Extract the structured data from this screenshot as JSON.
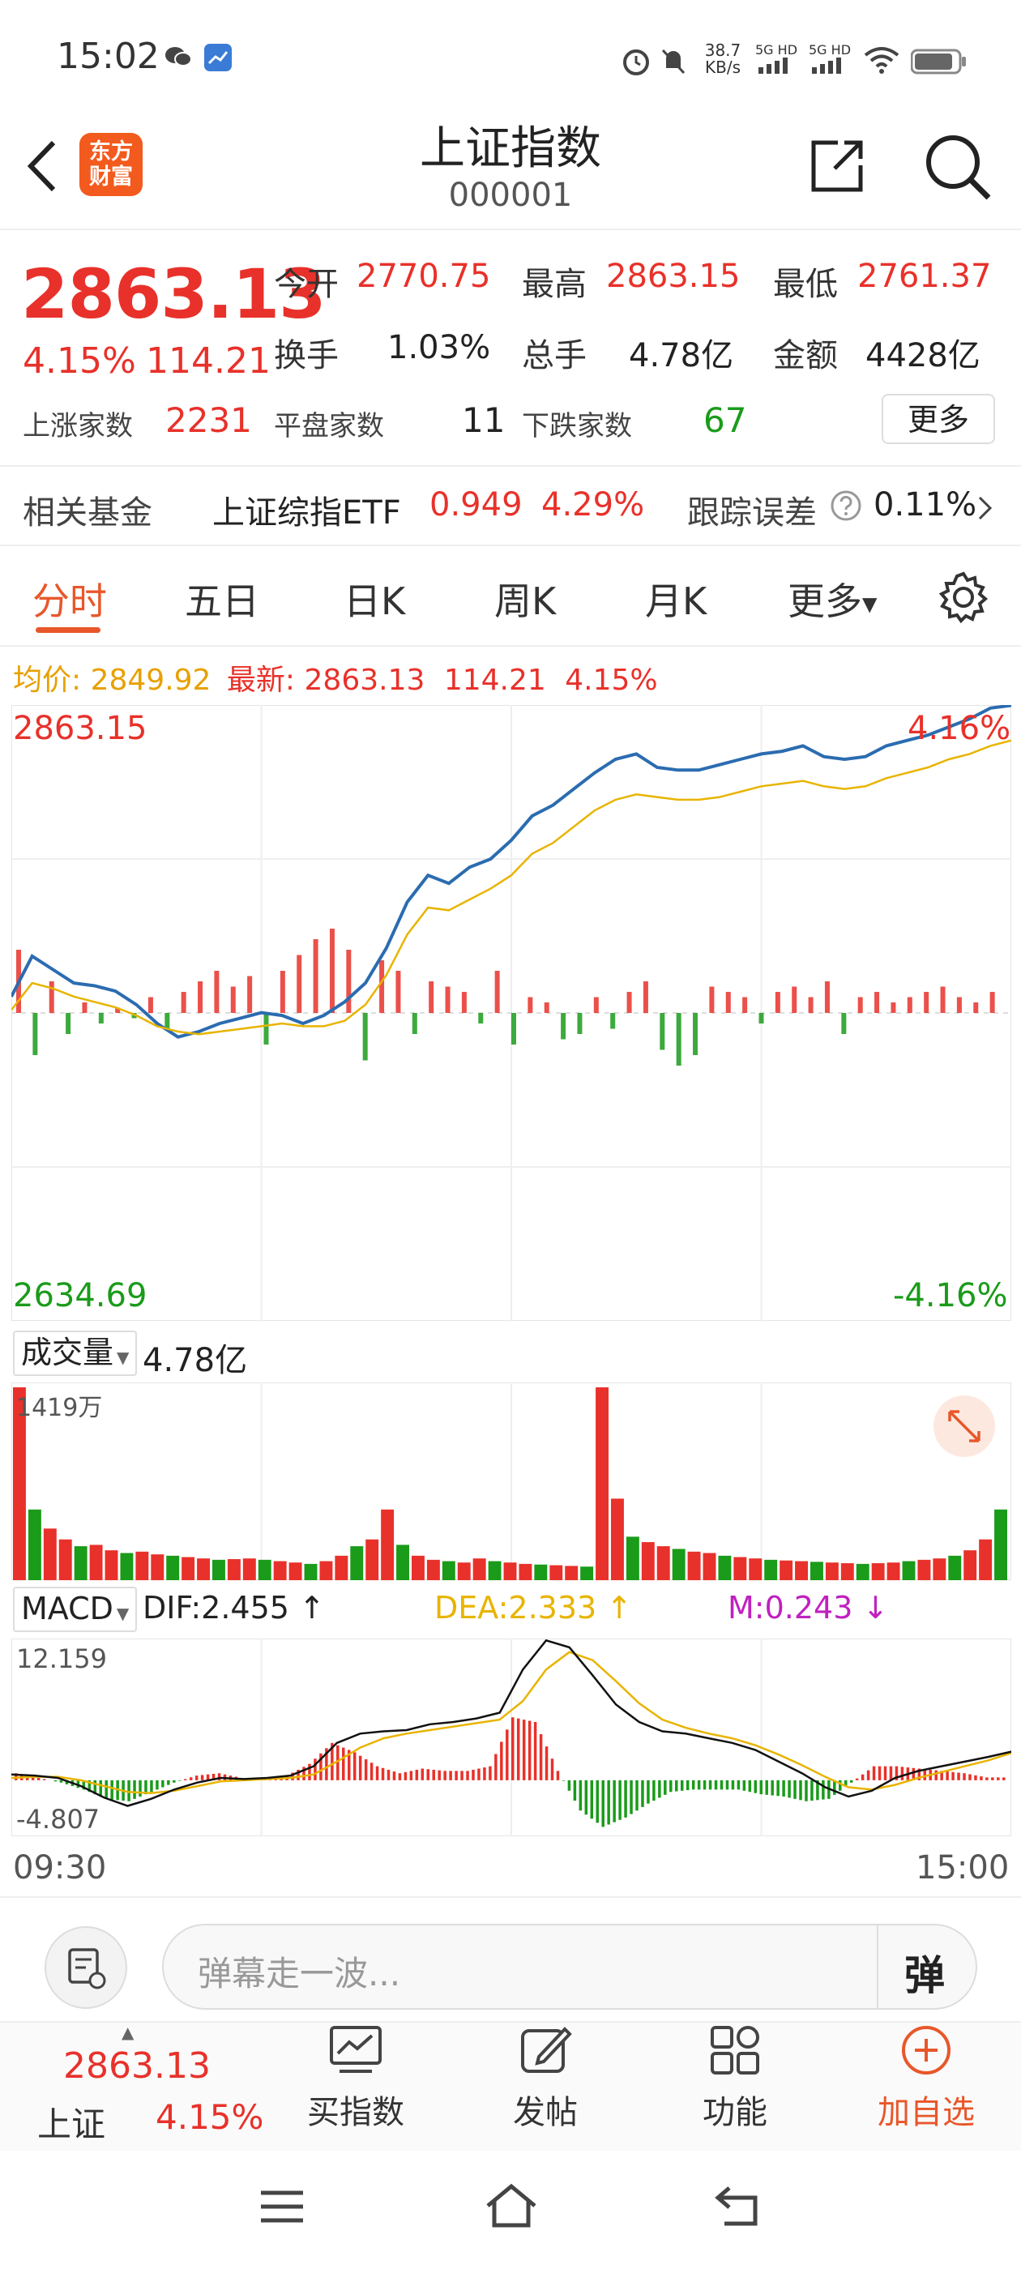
{
  "status_bar": {
    "time": "15:02",
    "net_speed_value": "38.7",
    "net_speed_unit": "KB/s",
    "sim1": "5G HD",
    "sim2": "5G HD"
  },
  "header": {
    "title": "上证指数",
    "code": "000001",
    "logo_line1": "东方",
    "logo_line2": "财富"
  },
  "quote": {
    "price": "2863.13",
    "change_pct": "4.15%",
    "change": "114.21",
    "open_label": "今开",
    "open": "2770.75",
    "high_label": "最高",
    "high": "2863.15",
    "low_label": "最低",
    "low": "2761.37",
    "turnover_label": "换手",
    "turnover": "1.03%",
    "volume_label": "总手",
    "volume": "4.78亿",
    "amount_label": "金额",
    "amount": "4428亿",
    "up_label": "上涨家数",
    "up": "2231",
    "flat_label": "平盘家数",
    "flat": "11",
    "down_label": "下跌家数",
    "down": "67",
    "more": "更多"
  },
  "fund": {
    "label": "相关基金",
    "name": "上证综指ETF",
    "price": "0.949",
    "pct": "4.29%",
    "err_label": "跟踪误差",
    "err": "0.11%"
  },
  "tabs": [
    "分时",
    "五日",
    "日K",
    "周K",
    "月K",
    "更多"
  ],
  "info_line": {
    "avg_label": "均价:",
    "avg": "2849.92",
    "latest_label": "最新:",
    "latest": "2863.13",
    "chg": "114.21",
    "pct": "4.15%"
  },
  "chart_data": {
    "type": "line",
    "x_start": "09:30",
    "x_end": "15:00",
    "y_max_label": "2863.15",
    "y_min_label": "2634.69",
    "pct_max_label": "4.16%",
    "pct_min_label": "-4.16%",
    "prev_close": 2748.92,
    "ylim": [
      2634.69,
      2863.15
    ],
    "series": [
      {
        "color": "#2b6cb0",
        "values": [
          2755,
          2770,
          2765,
          2760,
          2759,
          2757,
          2752,
          2745,
          2740,
          2742,
          2745,
          2747,
          2749,
          2748,
          2745,
          2748,
          2753,
          2760,
          2773,
          2790,
          2800,
          2797,
          2803,
          2806,
          2813,
          2822,
          2826,
          2832,
          2838,
          2843,
          2845,
          2840,
          2839,
          2839,
          2841,
          2843,
          2845,
          2846,
          2848,
          2844,
          2843,
          2844,
          2848,
          2850,
          2852,
          2855,
          2858,
          2862,
          2863
        ]
      },
      {
        "color": "#e8b400",
        "values": [
          2750,
          2760,
          2758,
          2755,
          2753,
          2751,
          2748,
          2744,
          2742,
          2741,
          2742,
          2743,
          2744,
          2745,
          2744,
          2744,
          2746,
          2752,
          2763,
          2778,
          2788,
          2787,
          2791,
          2795,
          2800,
          2808,
          2812,
          2818,
          2824,
          2828,
          2830,
          2829,
          2828,
          2828,
          2829,
          2831,
          2833,
          2834,
          2835,
          2833,
          2832,
          2833,
          2836,
          2838,
          2840,
          2843,
          2845,
          2848,
          2850
        ]
      }
    ],
    "breadth_bars": [
      60,
      -40,
      30,
      -20,
      10,
      -10,
      5,
      -5,
      15,
      -15,
      20,
      30,
      40,
      25,
      35,
      -30,
      40,
      55,
      70,
      80,
      60,
      -45,
      50,
      40,
      -20,
      30,
      25,
      20,
      -10,
      40,
      -30,
      15,
      10,
      -25,
      -20,
      15,
      -15,
      20,
      30,
      -35,
      -50,
      -40,
      25,
      20,
      15,
      -10,
      20,
      25,
      15,
      30,
      -20,
      15,
      20,
      10,
      15,
      20,
      25,
      15,
      10,
      20
    ],
    "volume": {
      "label": "成交量",
      "total": "4.78亿",
      "max_label": "1419万",
      "values": [
        1419,
        520,
        380,
        300,
        250,
        260,
        220,
        200,
        210,
        190,
        180,
        170,
        160,
        150,
        155,
        160,
        150,
        140,
        130,
        120,
        140,
        180,
        250,
        300,
        520,
        260,
        180,
        150,
        140,
        130,
        160,
        140,
        130,
        120,
        115,
        110,
        105,
        100,
        1419,
        600,
        320,
        280,
        250,
        230,
        210,
        200,
        180,
        170,
        160,
        150,
        145,
        140,
        135,
        130,
        125,
        120,
        125,
        130,
        140,
        150,
        160,
        180,
        220,
        300,
        520
      ]
    },
    "macd": {
      "label": "MACD",
      "dif": "DIF:2.455",
      "dea": "DEA:2.333",
      "m": "M:0.243",
      "y_max_label": "12.159",
      "y_min_label": "-4.807",
      "ylim": [
        -4.807,
        12.159
      ],
      "dif_values": [
        0.5,
        0.4,
        0.2,
        -0.5,
        -1.5,
        -2.2,
        -1.6,
        -0.8,
        -0.2,
        0.2,
        0.1,
        0.2,
        0.4,
        1.2,
        3.2,
        4.0,
        4.2,
        4.3,
        4.8,
        5.0,
        5.3,
        5.8,
        9.5,
        12.0,
        11.4,
        9.0,
        6.5,
        5.0,
        4.2,
        4.0,
        3.6,
        3.2,
        2.6,
        1.6,
        0.6,
        -0.6,
        -1.4,
        -0.9,
        0.2,
        0.8,
        1.2,
        1.6,
        2.0,
        2.455
      ],
      "dea_values": [
        0.2,
        0.3,
        0.3,
        0.0,
        -0.5,
        -1.0,
        -1.1,
        -0.9,
        -0.5,
        -0.1,
        0.0,
        0.1,
        0.2,
        0.5,
        1.6,
        2.8,
        3.6,
        4.0,
        4.3,
        4.6,
        4.9,
        5.2,
        6.8,
        9.5,
        11.0,
        10.3,
        8.5,
        6.6,
        5.2,
        4.5,
        4.0,
        3.6,
        3.0,
        2.2,
        1.3,
        0.3,
        -0.6,
        -0.8,
        -0.4,
        0.2,
        0.7,
        1.2,
        1.7,
        2.333
      ],
      "hist_values": [
        0.6,
        0.2,
        -0.2,
        -0.8,
        -1.6,
        -1.8,
        -1.0,
        -0.2,
        0.4,
        0.6,
        0.2,
        0.2,
        0.4,
        1.4,
        3.2,
        2.4,
        1.2,
        0.6,
        1.0,
        0.8,
        0.8,
        1.2,
        5.4,
        5.0,
        0.8,
        -2.6,
        -4.0,
        -3.2,
        -2.0,
        -1.0,
        -0.8,
        -0.8,
        -0.8,
        -1.2,
        -1.4,
        -1.8,
        -1.6,
        -0.2,
        1.2,
        1.2,
        1.0,
        0.8,
        0.6,
        0.243
      ]
    }
  },
  "danmu": {
    "placeholder": "弹幕走一波...",
    "btn": "弹"
  },
  "bottom_bar": {
    "index_price": "2863.13",
    "index_name": "上证",
    "index_pct": "4.15%",
    "buy": "买指数",
    "post": "发帖",
    "func": "功能",
    "add": "加自选"
  },
  "colors": {
    "up": "#e8312a",
    "down": "#1a9b1a",
    "accent": "#e8572a",
    "price_line": "#2b6cb0",
    "avg_line": "#e8b400",
    "macd_m": "#c020c0"
  }
}
